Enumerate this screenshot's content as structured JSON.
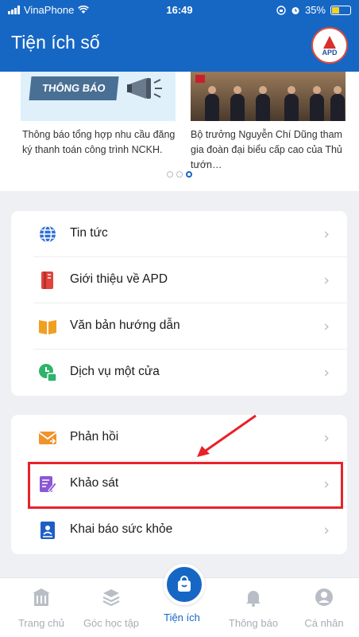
{
  "status": {
    "carrier": "VinaPhone",
    "time": "16:49",
    "battery": "35%"
  },
  "appbar": {
    "title": "Tiện ích số",
    "logo_text": "APD"
  },
  "banner": {
    "card1_label": "THÔNG BÁO",
    "caption1": "Thông báo tổng hợp nhu cầu đăng ký thanh toán công trình NCKH.",
    "caption2": "Bộ trưởng Nguyễn Chí Dũng tham gia đoàn đại biểu cấp cao của Thủ tướn…"
  },
  "menu1": [
    {
      "label": "Tin tức",
      "icon": "globe-icon",
      "color": "#2f6fd6"
    },
    {
      "label": "Giới thiệu về APD",
      "icon": "bookmark-icon",
      "color": "#e0443a"
    },
    {
      "label": "Văn bản hướng dẫn",
      "icon": "book-icon",
      "color": "#f0a020"
    },
    {
      "label": "Dịch vụ một cửa",
      "icon": "service-icon",
      "color": "#2fb36a"
    }
  ],
  "menu2": [
    {
      "label": "Phản hồi",
      "icon": "mail-icon",
      "color": "#f0932b"
    },
    {
      "label": "Khảo sát",
      "icon": "survey-icon",
      "color": "#8a58d6"
    },
    {
      "label": "Khai báo sức khỏe",
      "icon": "health-icon",
      "color": "#1e5fc6"
    }
  ],
  "tabs": [
    {
      "label": "Trang chủ"
    },
    {
      "label": "Góc học tập"
    },
    {
      "label": "Tiện ích"
    },
    {
      "label": "Thông báo"
    },
    {
      "label": "Cá nhân"
    }
  ],
  "active_tab": "Tiện ích"
}
